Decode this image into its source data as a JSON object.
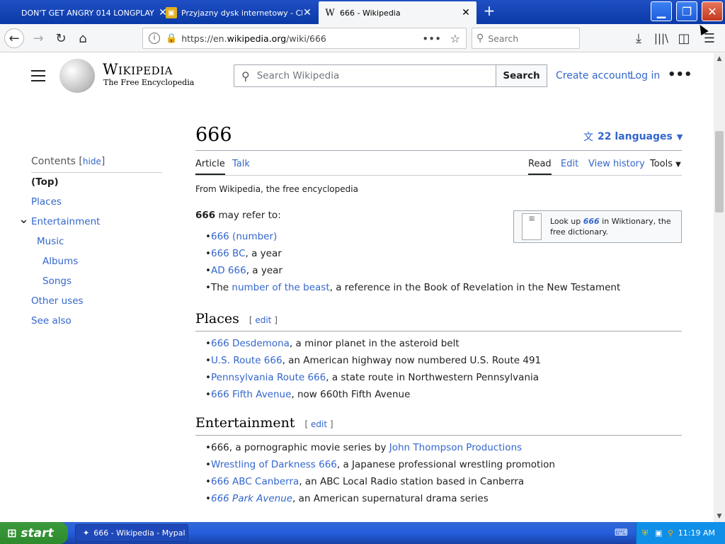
{
  "browser": {
    "tabs": [
      {
        "title": "DON'T GET ANGRY 014 LONGPLAY",
        "icon": "none"
      },
      {
        "title": "Przyjazny dysk internetowy - Cho",
        "icon": "drive-icon"
      },
      {
        "title": "666 - Wikipedia",
        "icon": "wikipedia-w-icon"
      }
    ],
    "url_prefix": "https://en.",
    "url_domain": "wikipedia.org",
    "url_path": "/wiki/666",
    "search_placeholder": "Search"
  },
  "wiki": {
    "logo_wordmark": "Wikipedia",
    "logo_tagline": "The Free Encyclopedia",
    "search_placeholder": "Search Wikipedia",
    "search_button": "Search",
    "create_account": "Create account",
    "login": "Log in",
    "title": "666",
    "languages": "22 languages",
    "tabs": {
      "article": "Article",
      "talk": "Talk",
      "read": "Read",
      "edit": "Edit",
      "history": "View history",
      "tools": "Tools"
    },
    "from": "From Wikipedia, the free encyclopedia",
    "intro_bold": "666",
    "intro_rest": " may refer to:",
    "wiktionary": {
      "pre": "Look up ",
      "term": "666",
      "post": " in Wiktionary, the free dictionary."
    },
    "intro_items": [
      {
        "link": "666 (number)",
        "rest": ""
      },
      {
        "link": "666 BC",
        "rest": ", a year"
      },
      {
        "link": "AD 666",
        "rest": ", a year"
      },
      {
        "pre": "The ",
        "link": "number of the beast",
        "rest": ", a reference in the Book of Revelation in the New Testament"
      }
    ],
    "sections": [
      {
        "heading": "Places",
        "edit": "edit",
        "items": [
          {
            "link": "666 Desdemona",
            "rest": ", a minor planet in the asteroid belt"
          },
          {
            "link": "U.S. Route 666",
            "rest": ", an American highway now numbered U.S. Route 491"
          },
          {
            "link": "Pennsylvania Route 666",
            "rest": ", a state route in Northwestern Pennsylvania"
          },
          {
            "link": "666 Fifth Avenue",
            "rest": ", now 660th Fifth Avenue"
          }
        ]
      },
      {
        "heading": "Entertainment",
        "edit": "edit",
        "items": [
          {
            "pre": "666, a pornographic movie series by ",
            "link": "John Thompson Productions",
            "rest": ""
          },
          {
            "link": "Wrestling of Darkness 666",
            "rest": ", a Japanese professional wrestling promotion"
          },
          {
            "link": "666 ABC Canberra",
            "rest": ", an ABC Local Radio station based in Canberra"
          },
          {
            "link": "666 Park Avenue",
            "rest": ", an American supernatural drama series",
            "italic": true
          }
        ]
      }
    ],
    "toc": {
      "title": "Contents",
      "hide": "hide",
      "items": [
        {
          "label": "(Top)",
          "level": 0,
          "bold": true
        },
        {
          "label": "Places",
          "level": 0
        },
        {
          "label": "Entertainment",
          "level": 0,
          "expanded": true
        },
        {
          "label": "Music",
          "level": 1
        },
        {
          "label": "Albums",
          "level": 2
        },
        {
          "label": "Songs",
          "level": 2
        },
        {
          "label": "Other uses",
          "level": 0
        },
        {
          "label": "See also",
          "level": 0
        }
      ]
    }
  },
  "taskbar": {
    "start": "start",
    "item": "666 - Wikipedia - Mypal",
    "clock": "11:19 AM"
  }
}
